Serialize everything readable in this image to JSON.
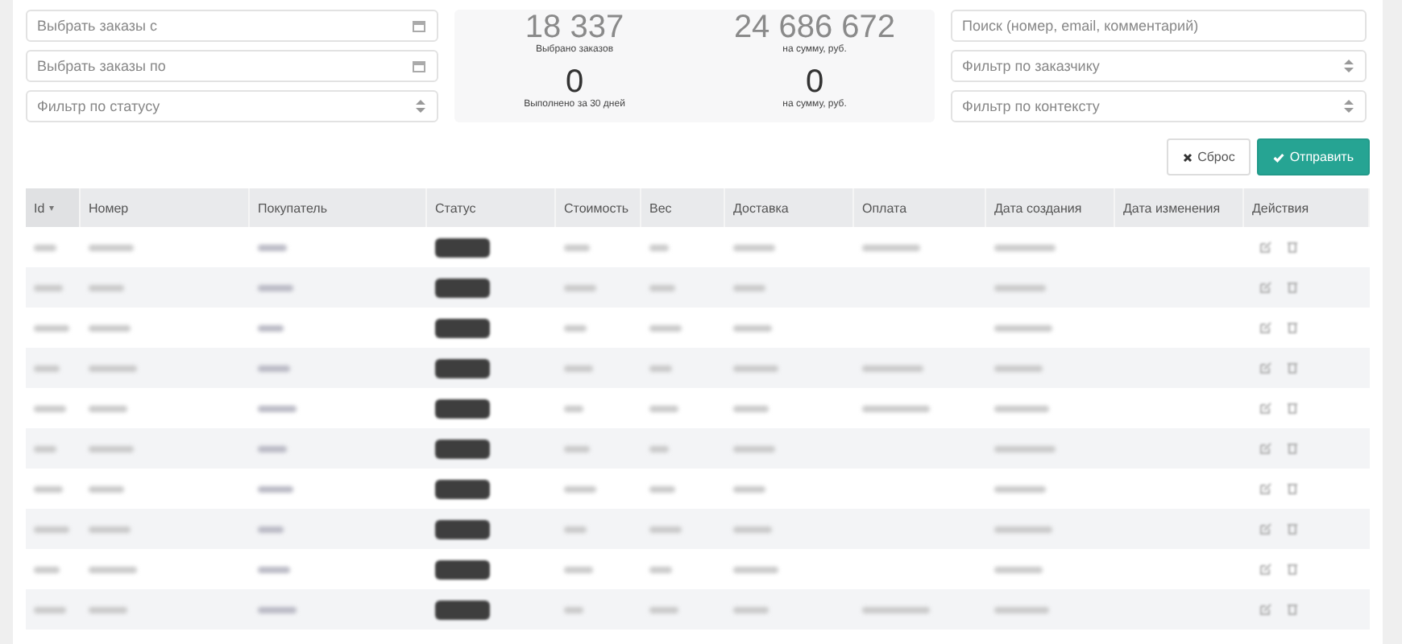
{
  "filters_left": [
    {
      "kind": "date",
      "placeholder": "Выбрать заказы с"
    },
    {
      "kind": "date",
      "placeholder": "Выбрать заказы по"
    },
    {
      "kind": "select",
      "placeholder": "Фильтр по статусу"
    }
  ],
  "stats": [
    {
      "value": "18 337",
      "label": "Выбрано заказов",
      "blurred": true
    },
    {
      "value": "24 686 672",
      "label": "на сумму, руб.",
      "blurred": true
    },
    {
      "value": "0",
      "label": "Выполнено за 30 дней",
      "blurred": false
    },
    {
      "value": "0",
      "label": "на сумму, руб.",
      "blurred": false
    }
  ],
  "filters_right": [
    {
      "kind": "text",
      "placeholder": "Поиск (номер, email, комментарий)"
    },
    {
      "kind": "select",
      "placeholder": "Фильтр по заказчику"
    },
    {
      "kind": "select",
      "placeholder": "Фильтр по контексту"
    }
  ],
  "buttons": [
    {
      "kind": "reset",
      "label": "Сброс"
    },
    {
      "kind": "submit",
      "label": "Отправить"
    }
  ],
  "table": {
    "columns": [
      {
        "label": "Id",
        "sort": "▾"
      },
      {
        "label": "Номер"
      },
      {
        "label": "Покупатель"
      },
      {
        "label": "Статус"
      },
      {
        "label": "Стоимость"
      },
      {
        "label": "Вес"
      },
      {
        "label": "Доставка"
      },
      {
        "label": "Оплата"
      },
      {
        "label": "Дата создания"
      },
      {
        "label": "Дата изменения"
      },
      {
        "label": "Действия"
      }
    ],
    "rows": [
      {
        "redacted": true,
        "payment_shown": true
      },
      {
        "redacted": true,
        "payment_shown": false
      },
      {
        "redacted": true,
        "payment_shown": false
      },
      {
        "redacted": true,
        "payment_shown": true
      },
      {
        "redacted": true,
        "payment_shown": true
      },
      {
        "redacted": true,
        "payment_shown": false
      },
      {
        "redacted": true,
        "payment_shown": false
      },
      {
        "redacted": true,
        "payment_shown": false
      },
      {
        "redacted": true,
        "payment_shown": false
      },
      {
        "redacted": true,
        "payment_shown": true
      }
    ]
  }
}
